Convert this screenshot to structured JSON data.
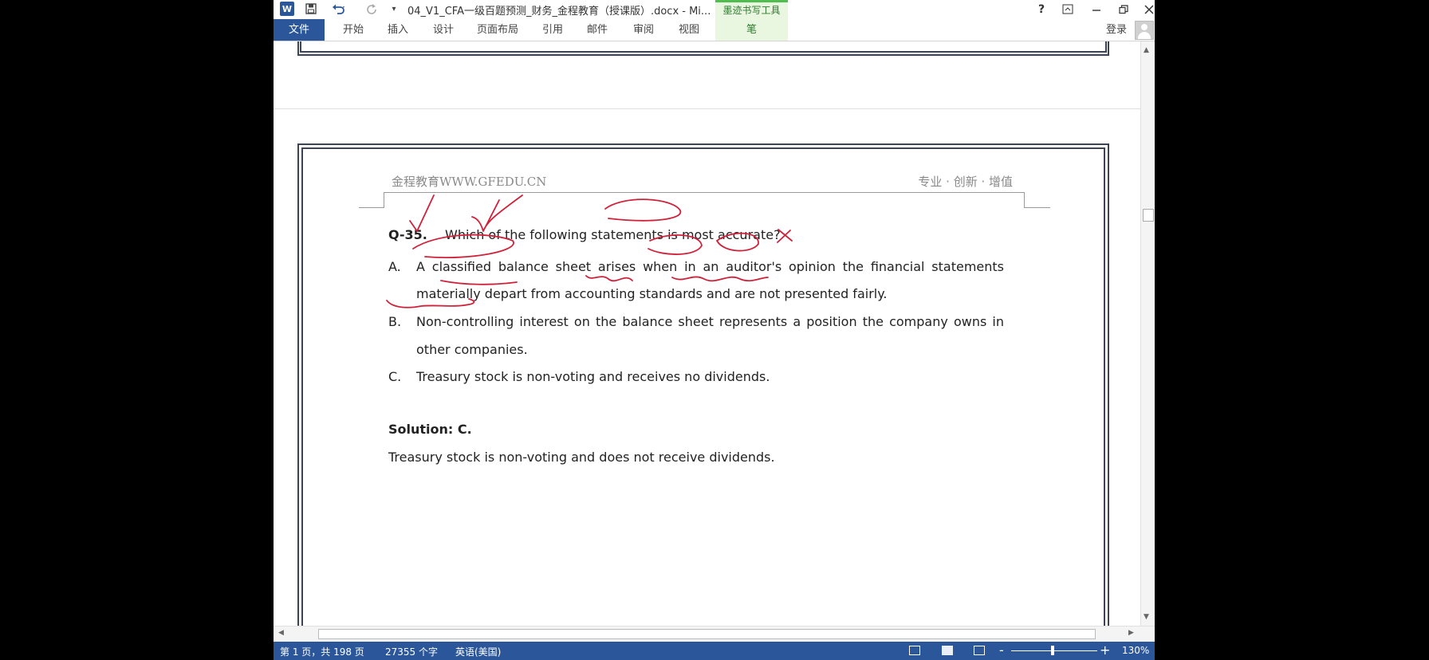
{
  "title_bar": {
    "word_icon": "W",
    "title": "04_V1_CFA一级百题预测_财务_金程教育（授课版）.docx - Mi...",
    "contextual_group": "墨迹书写工具",
    "help": "?"
  },
  "ribbon": {
    "tabs": [
      "文件",
      "开始",
      "插入",
      "设计",
      "页面布局",
      "引用",
      "邮件",
      "审阅",
      "视图",
      "笔"
    ],
    "sign_in": "登录"
  },
  "document": {
    "header_left": "金程教育WWW.GFEDU.CN",
    "header_right": "专业 · 创新 · 增值",
    "question_number": "Q-35.",
    "question_text": "Which of the following statements is most accurate?",
    "options": [
      {
        "letter": "A.",
        "lines": [
          "A classified balance sheet arises when in an auditor's opinion the financial statements",
          "materially depart from accounting standards and are not presented fairly."
        ]
      },
      {
        "letter": "B.",
        "lines": [
          "Non-controlling interest on the balance sheet represents a position the company owns in",
          "other companies."
        ]
      },
      {
        "letter": "C.",
        "lines": [
          "Treasury stock is non-voting and receives no dividends."
        ]
      }
    ],
    "solution_title": "Solution: C.",
    "solution_text": "Treasury stock is non-voting and does not receive dividends."
  },
  "status_bar": {
    "page_info": "第 1 页，共 198 页",
    "word_count": "27355 个字",
    "language": "英语(美国)",
    "zoom_minus": "-",
    "zoom_plus": "+",
    "zoom": "130%"
  },
  "ink_color": "#d0213a",
  "accent_color": "#2b579a",
  "icons": [
    "word-icon",
    "save-icon",
    "undo-icon",
    "redo-icon",
    "help-icon",
    "minimize-icon",
    "restore-icon",
    "close-icon",
    "avatar"
  ]
}
